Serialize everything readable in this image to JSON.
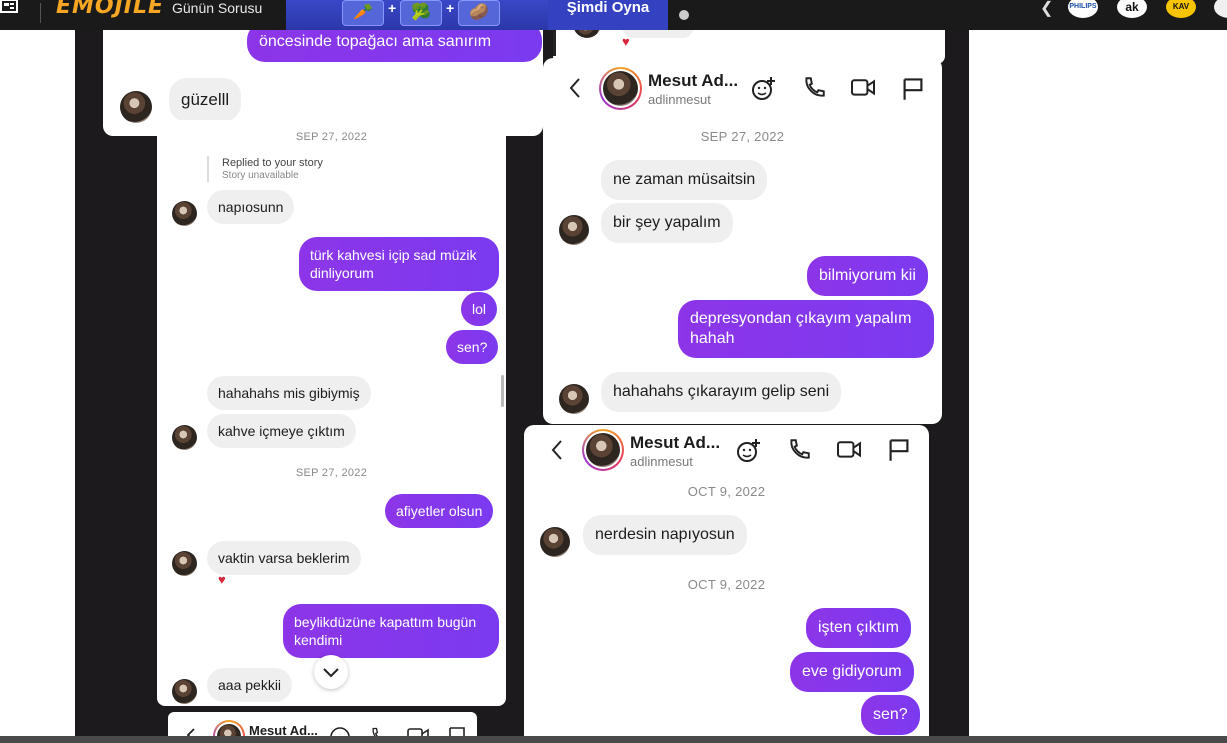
{
  "topbar": {
    "logo": "EMOJILE",
    "gunun": "Günün Sorusu",
    "tiles": [
      "🥕",
      "🥦",
      "🥔"
    ],
    "play": "Şimdi Oyna",
    "brands": [
      "PHILIPS",
      "ak",
      "KAV"
    ]
  },
  "top_left": {
    "out_msg": "öncesinde topağacı ama sanırım",
    "in_msg": "güzelll"
  },
  "left_panel": {
    "date1": "SEP 27, 2022",
    "reply_title": "Replied to your story",
    "reply_sub": "Story unavailable",
    "msg_napiosunn": "napıosunn",
    "msg_turk": "türk kahvesi içip sad müzik dinliyorum",
    "msg_lol": "lol",
    "msg_sen": "sen?",
    "msg_hahahahs": "hahahahs mis gibiymiş",
    "msg_kahve": "kahve içmeye çıktım",
    "date2": "SEP 27, 2022",
    "msg_afiyet": "afiyetler olsun",
    "msg_vaktin": "vaktin varsa beklerim",
    "heart": "♥",
    "msg_beylik": "beylikdüzüne kapattım bugün kendimi",
    "msg_aaa": "aaa pekkii"
  },
  "right_top_panel": {
    "heart": "♥",
    "name": "Mesut Ad...",
    "username": "adlinmesut",
    "date": "SEP 27, 2022",
    "msg_ne_zaman": "ne zaman müsaitsin",
    "msg_bir_sey": "bir şey yapalım",
    "msg_bilmiyorum": "bilmiyorum kii",
    "msg_depresyon": "depresyondan çıkayım yapalım hahah",
    "msg_hahahahs": "hahahahs çıkarayım gelip seni"
  },
  "right_bottom_panel": {
    "name": "Mesut Ad...",
    "username": "adlinmesut",
    "date1": "OCT 9, 2022",
    "msg_nerdesin": "nerdesin napıyosun",
    "date2": "OCT 9, 2022",
    "msg_isten": "işten çıktım",
    "msg_eve": "eve gidiyorum",
    "msg_sen": "sen?"
  },
  "bottom_mini_header": {
    "name": "Mesut Ad..."
  },
  "colors": {
    "outgoing": "#8d35e8",
    "incoming": "#efefef",
    "frame": "#1d1a1d"
  }
}
